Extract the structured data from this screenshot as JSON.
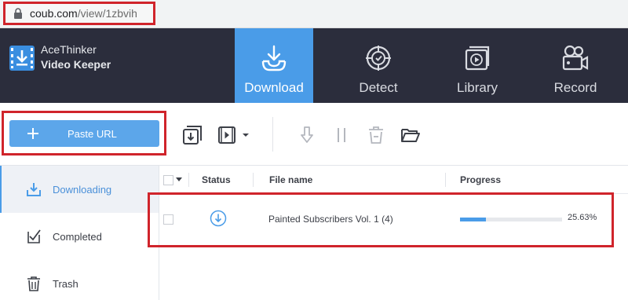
{
  "browser": {
    "url_host": "coub.com",
    "url_path": "/view/1zbvih"
  },
  "app": {
    "name_line1": "AceThinker",
    "name_line2": "Video Keeper"
  },
  "nav": {
    "tabs": [
      {
        "label": "Download",
        "icon": "download-tray-icon",
        "active": true
      },
      {
        "label": "Detect",
        "icon": "target-icon"
      },
      {
        "label": "Library",
        "icon": "video-library-icon"
      },
      {
        "label": "Record",
        "icon": "camera-icon"
      }
    ]
  },
  "toolbar": {
    "paste_label": "Paste URL",
    "icons": [
      "download-batch-icon",
      "video-options-icon",
      "resume-icon",
      "pause-icon",
      "delete-icon",
      "open-folder-icon"
    ]
  },
  "sidebar": {
    "items": [
      {
        "label": "Downloading",
        "icon": "download-icon",
        "active": true
      },
      {
        "label": "Completed",
        "icon": "check-doc-icon"
      },
      {
        "label": "Trash",
        "icon": "trash-icon"
      }
    ]
  },
  "table": {
    "headers": {
      "status": "Status",
      "file_name": "File name",
      "progress": "Progress"
    },
    "rows": [
      {
        "status_icon": "downloading-status-icon",
        "file_name": "Painted Subscribers Vol. 1 (4)",
        "progress": 25.63,
        "progress_text": "25.63%"
      }
    ]
  },
  "colors": {
    "accent": "#4a9ce8",
    "header_bg": "#2b2d3c",
    "highlight": "#d0242b"
  }
}
